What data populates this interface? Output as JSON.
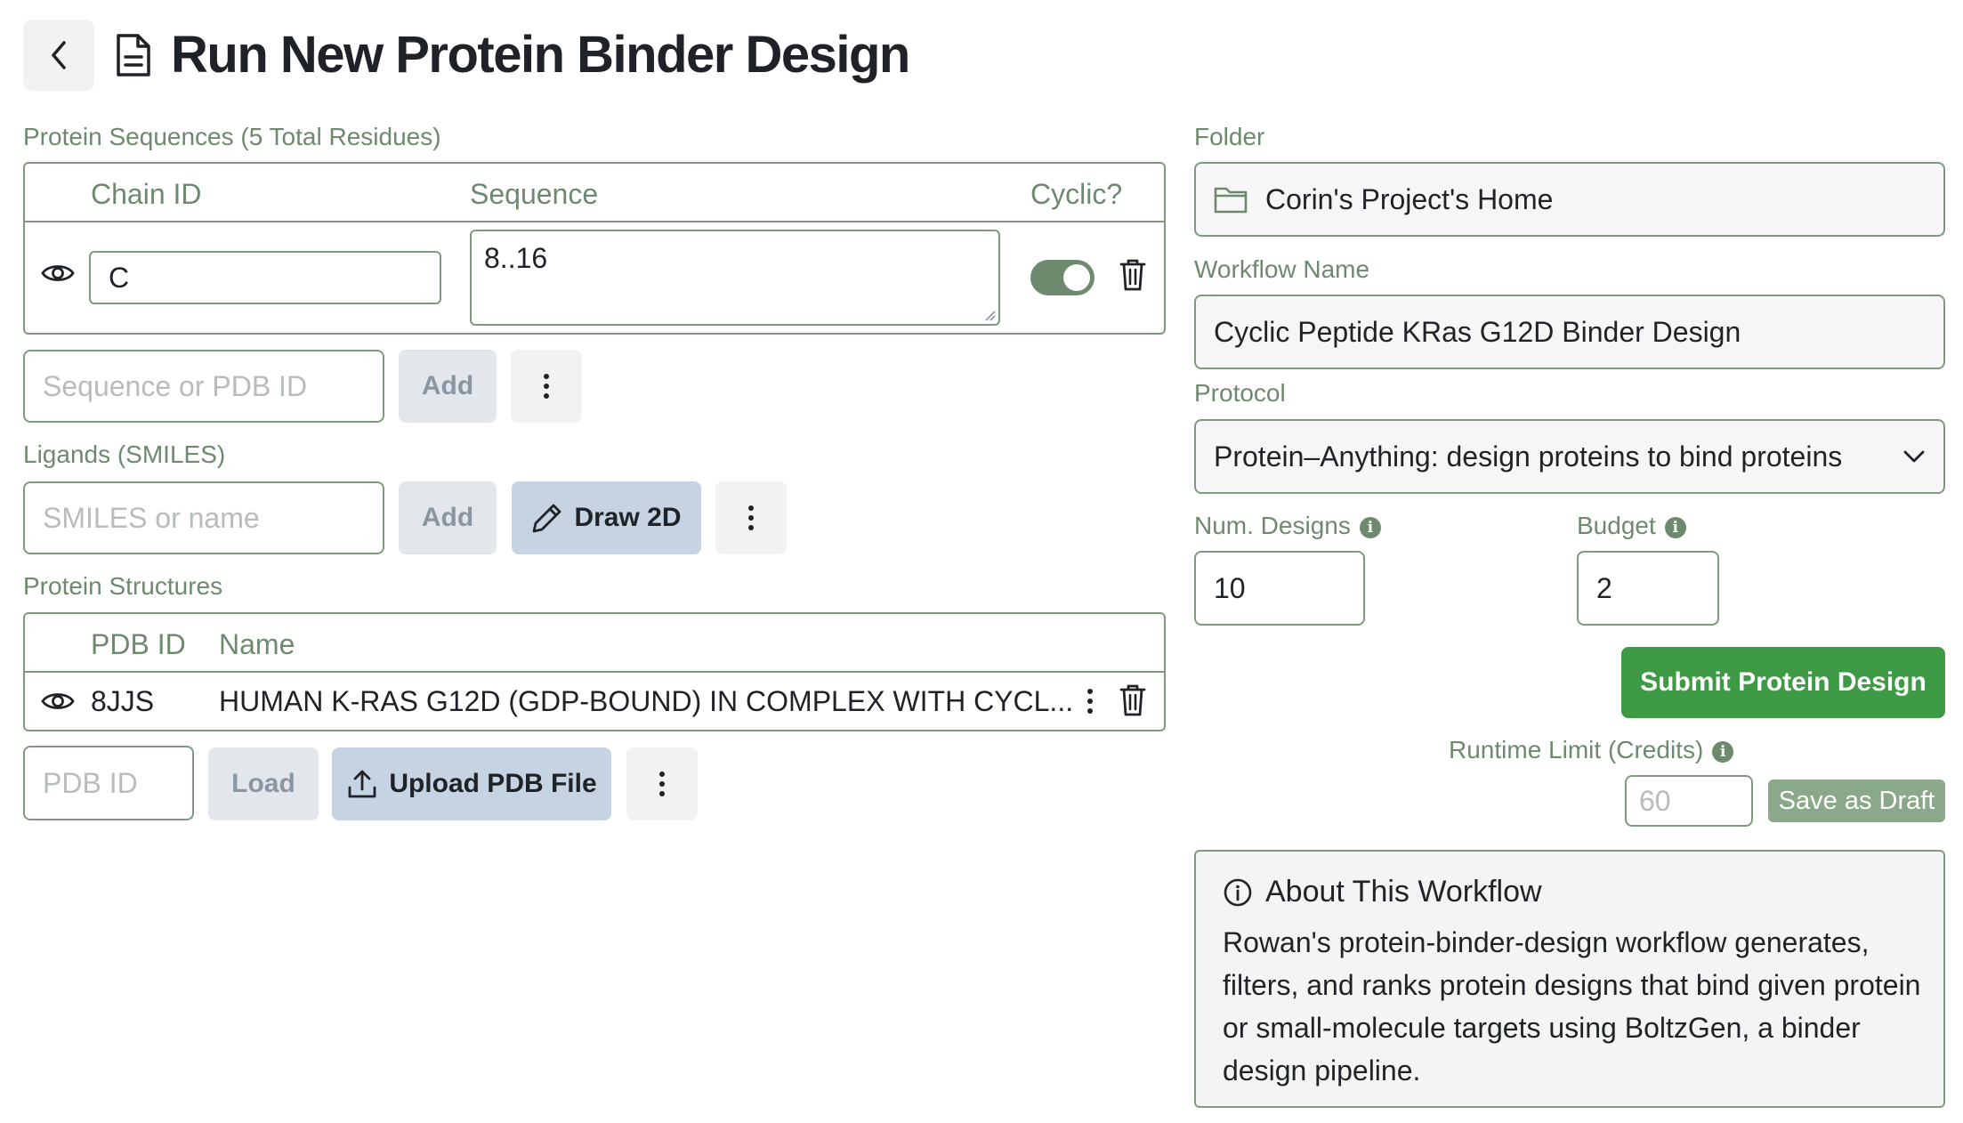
{
  "header": {
    "title": "Run New Protein Binder Design"
  },
  "protein_sequences": {
    "label": "Protein Sequences (5 Total Residues)",
    "columns": {
      "chain_id": "Chain ID",
      "sequence": "Sequence",
      "cyclic": "Cyclic?"
    },
    "rows": [
      {
        "chain_id": "C",
        "sequence": "8..16",
        "cyclic": true
      }
    ],
    "add_placeholder": "Sequence or PDB ID",
    "add_label": "Add"
  },
  "ligands": {
    "label": "Ligands (SMILES)",
    "placeholder": "SMILES or name",
    "add_label": "Add",
    "draw_label": "Draw 2D"
  },
  "protein_structures": {
    "label": "Protein Structures",
    "columns": {
      "pdb_id": "PDB ID",
      "name": "Name"
    },
    "rows": [
      {
        "pdb_id": "8JJS",
        "name": "HUMAN K-RAS G12D (GDP-BOUND) IN COMPLEX WITH CYCL..."
      }
    ],
    "pdb_placeholder": "PDB ID",
    "load_label": "Load",
    "upload_label": "Upload PDB File"
  },
  "form": {
    "folder_label": "Folder",
    "folder_value": "Corin's Project's Home",
    "workflow_name_label": "Workflow Name",
    "workflow_name_value": "Cyclic Peptide KRas G12D Binder Design",
    "protocol_label": "Protocol",
    "protocol_value": "Protein–Anything: design proteins to bind proteins",
    "num_designs_label": "Num. Designs",
    "num_designs_value": "10",
    "budget_label": "Budget",
    "budget_value": "2",
    "submit_label": "Submit Protein Design",
    "runtime_limit_label": "Runtime Limit (Credits)",
    "runtime_limit_placeholder": "60",
    "save_draft_label": "Save as Draft",
    "info_glyph": "i"
  },
  "about": {
    "title": "About This Workflow",
    "text": "Rowan's protein-binder-design workflow generates, filters, and ranks protein designs that bind given protein or small-molecule targets using BoltzGen, a binder design pipeline."
  },
  "colors": {
    "accent_green": "#3f9a45",
    "label_green": "#6e8a6e",
    "border_green": "#7f9a7f",
    "blue_button": "#c6d3e3"
  }
}
